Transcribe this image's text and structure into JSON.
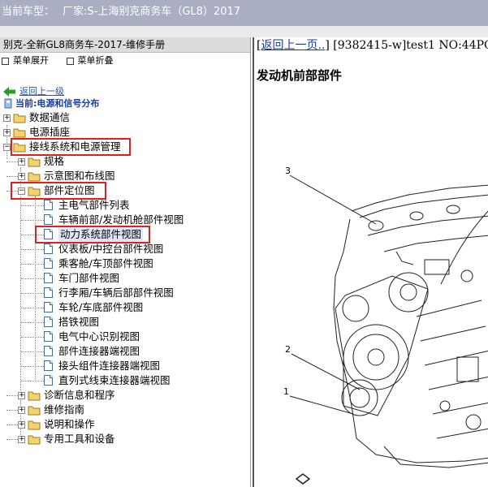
{
  "title_bar": {
    "vehicle_label": "当前车型：",
    "maker": "厂家:S-上海别克商务车（GL8）2017"
  },
  "left_panel": {
    "manual_title": "别克-全新GL8商务车-2017-维修手册",
    "menu": {
      "expand_label": "菜单展开",
      "collapse_label": "菜单折叠"
    },
    "back_link": "返回上一级",
    "current_label": "当前:电源和信号分布",
    "tree": [
      {
        "label": "数据通信",
        "expander": "+"
      },
      {
        "label": "电源插座",
        "expander": "+"
      },
      {
        "label": "接线系统和电源管理",
        "expander": "-",
        "highlighted": true
      },
      {
        "label": "规格",
        "expander": "+"
      },
      {
        "label": "示意图和布线图",
        "expander": "+"
      },
      {
        "label": "部件定位图",
        "expander": "-",
        "highlighted": true
      },
      {
        "label": "主电气部件列表"
      },
      {
        "label": "车辆前部/发动机舱部件视图"
      },
      {
        "label": "动力系统部件视图",
        "highlighted": true,
        "selected": true
      },
      {
        "label": "仪表板/中控台部件视图"
      },
      {
        "label": "乘客舱/车顶部件视图"
      },
      {
        "label": "车门部件视图"
      },
      {
        "label": "行李厢/车辆后部部件视图"
      },
      {
        "label": "车轮/车底部件视图"
      },
      {
        "label": "搭铁视图"
      },
      {
        "label": "电气中心识别视图"
      },
      {
        "label": "部件连接器端视图"
      },
      {
        "label": "接头组件连接器端视图"
      },
      {
        "label": "直列式线束连接器端视图"
      },
      {
        "label": "诊断信息和程序",
        "expander": "+"
      },
      {
        "label": "维修指南",
        "expander": "+"
      },
      {
        "label": "说明和操作",
        "expander": "+"
      },
      {
        "label": "专用工具和设备",
        "expander": "+"
      }
    ]
  },
  "right_panel": {
    "bracket_open": "[",
    "back_link": "返回上一页..",
    "doc_info": "] [9382415-w]test1 NO:44PC:",
    "section_title": "发动机前部部件",
    "callouts": [
      "3",
      "2",
      "1"
    ]
  },
  "colors": {
    "title_bar": "#a9aec3",
    "highlight": "#e02020",
    "link": "#2a56a0",
    "current": "#1c3c96"
  }
}
